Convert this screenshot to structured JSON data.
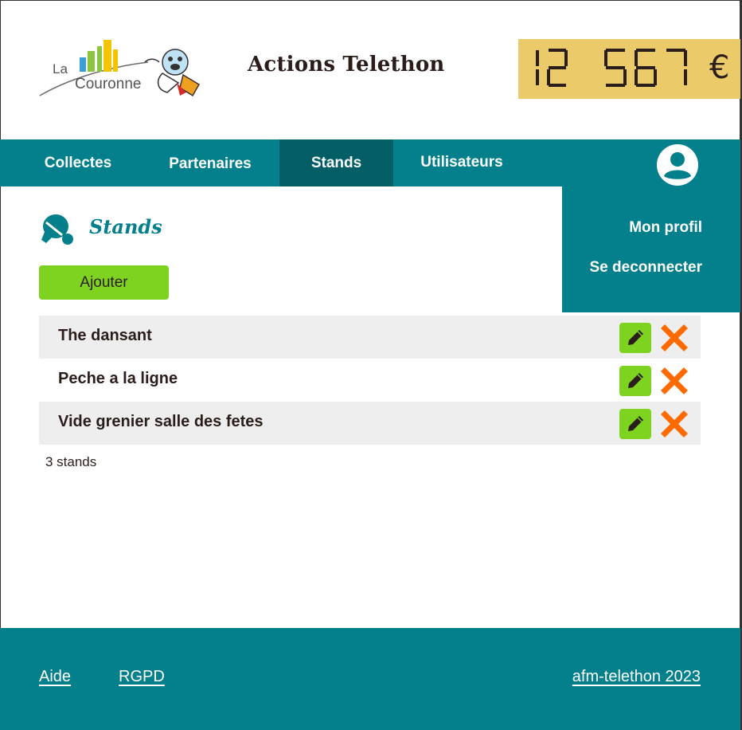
{
  "header": {
    "logo_text_line1": "La",
    "logo_text_line2": "Couronne",
    "title": "Actions Telethon",
    "counter": {
      "value": "12 567",
      "currency": "€",
      "background": "#ebcb69"
    }
  },
  "nav": {
    "items": [
      {
        "label": "Collectes",
        "active": false
      },
      {
        "label": "Partenaires",
        "active": false
      },
      {
        "label": "Stands",
        "active": true
      },
      {
        "label": "Utilisateurs",
        "active": false
      }
    ],
    "avatar_icon": "user-circle-icon"
  },
  "profile_menu": {
    "items": [
      {
        "label": "Mon profil"
      },
      {
        "label": "Se deconnecter"
      }
    ]
  },
  "section": {
    "icon": "ping-pong-icon",
    "title": "Stands",
    "add_label": "Ajouter"
  },
  "stands": [
    {
      "name": "The dansant"
    },
    {
      "name": "Peche a la ligne"
    },
    {
      "name": "Vide grenier salle des fetes"
    }
  ],
  "row_actions": {
    "edit_icon": "pencil-icon",
    "delete_icon": "close-icon"
  },
  "count_label": "3 stands",
  "footer": {
    "links": [
      {
        "label": "Aide"
      },
      {
        "label": "RGPD"
      }
    ],
    "copyright": "afm-telethon 2023"
  },
  "colors": {
    "primary": "#04808c",
    "primary_dark": "#035e66",
    "accent_green": "#7ed321",
    "delete_orange": "#ff6a00",
    "counter_yellow": "#ebcb69"
  }
}
